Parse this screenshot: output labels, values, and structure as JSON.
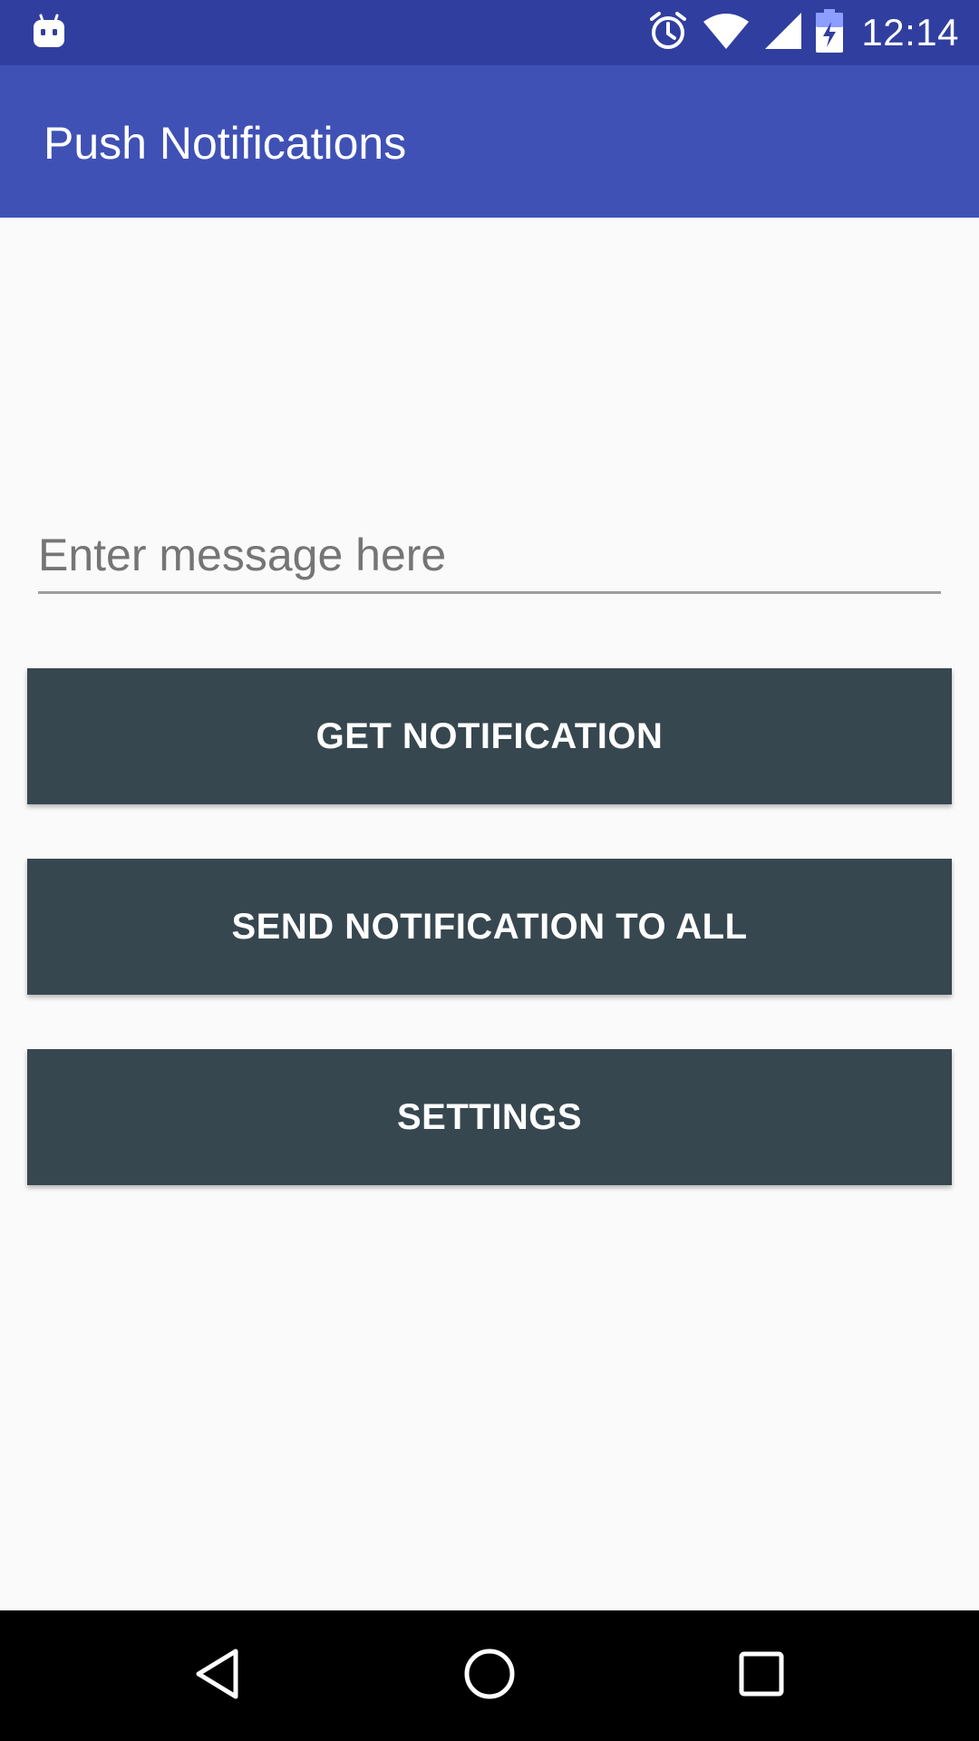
{
  "status_bar": {
    "time": "12:14",
    "left_icon": "android-debug-icon",
    "icons": [
      "alarm-icon",
      "wifi-icon",
      "cell-signal-icon",
      "battery-charging-icon"
    ],
    "background_color": "#303f9f"
  },
  "app_bar": {
    "title": "Push Notifications",
    "background_color": "#3f51b5"
  },
  "message_input": {
    "placeholder": "Enter message here",
    "value": ""
  },
  "buttons": {
    "get_notification": "GET NOTIFICATION",
    "send_to_all": "SEND NOTIFICATION TO ALL",
    "settings": "SETTINGS",
    "background_color": "#37474f"
  },
  "nav_bar": {
    "icons": [
      "back-icon",
      "home-icon",
      "recents-icon"
    ]
  }
}
